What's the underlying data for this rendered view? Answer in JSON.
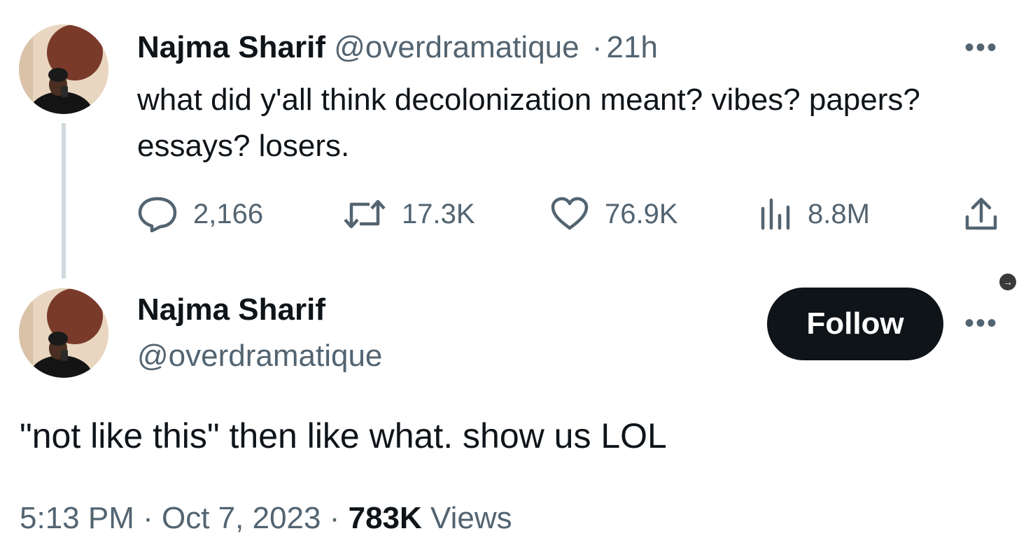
{
  "parent_tweet": {
    "author_name": "Najma Sharif",
    "handle": "@overdramatique",
    "separator": "·",
    "time_ago": "21h",
    "text": "what did y'all think decolonization meant? vibes? papers? essays? losers.",
    "actions": {
      "replies": "2,166",
      "reposts": "17.3K",
      "likes": "76.9K",
      "views": "8.8M"
    },
    "more_label": "•••"
  },
  "main_tweet": {
    "author_name": "Najma Sharif",
    "handle": "@overdramatique",
    "follow_label": "Follow",
    "more_label": "•••",
    "text": "\"not like this\" then like what. show us LOL",
    "time": "5:13 PM",
    "separator": "·",
    "date": "Oct 7, 2023",
    "views_count": "783K",
    "views_label": "Views"
  },
  "nav_arrow": "→",
  "colors": {
    "text_primary": "#0f1419",
    "text_secondary": "#536471",
    "follow_bg": "#0f1419",
    "thread_line": "#cfd9de"
  },
  "icons": [
    "reply-icon",
    "repost-icon",
    "like-icon",
    "views-icon",
    "share-icon"
  ]
}
